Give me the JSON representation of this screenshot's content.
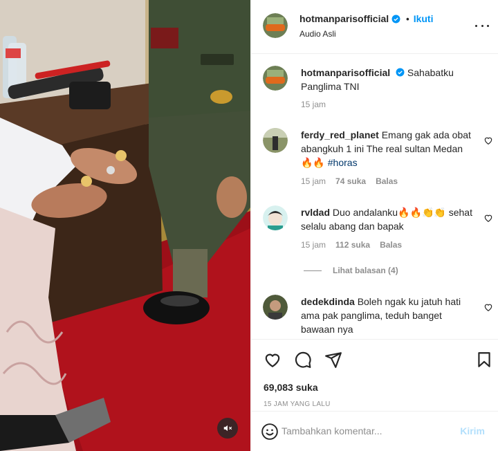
{
  "post": {
    "username": "hotmanparisofficial",
    "follow_label": "Ikuti",
    "audio_label": "Audio Asli",
    "caption_text": "Sahabatku Panglima TNI",
    "caption_time": "15 jam"
  },
  "comments": [
    {
      "username": "ferdy_red_planet",
      "text": "Emang gak ada obat abangkuh 1 ini The real sultan Medan 🔥🔥",
      "hashtag": "#horas",
      "time": "15 jam",
      "likes": "74 suka",
      "reply_label": "Balas"
    },
    {
      "username": "rvldad",
      "text": "Duo andalanku🔥🔥👏👏 sehat selalu abang dan bapak",
      "time": "15 jam",
      "likes": "112 suka",
      "reply_label": "Balas",
      "view_replies": "Lihat balasan (4)"
    },
    {
      "username": "dedekdinda",
      "text": "Boleh ngak ku jatuh hati ama pak panglima, teduh banget bawaan nya"
    }
  ],
  "actions": {
    "likes_count": "69,083 suka",
    "time_ago": "15 JAM YANG LALU"
  },
  "add_comment": {
    "placeholder": "Tambahkan komentar...",
    "post_label": "Kirim"
  },
  "colors": {
    "accent": "#0095f6",
    "post_disabled": "#b2dffc",
    "secondary_text": "#8e8e8e"
  },
  "icons": [
    "verified-badge-icon",
    "more-options-icon",
    "heart-icon",
    "comment-icon",
    "share-icon",
    "bookmark-icon",
    "emoji-icon",
    "mute-icon"
  ]
}
